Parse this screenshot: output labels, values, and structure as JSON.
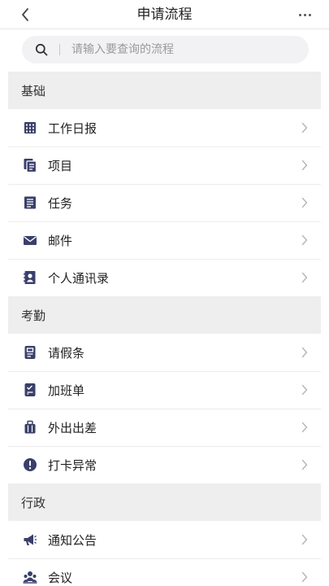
{
  "header": {
    "title": "申请流程",
    "back_icon": "chevron-left-icon",
    "more_icon": "more-dots-icon"
  },
  "search": {
    "placeholder": "请输入要查询的流程",
    "value": ""
  },
  "colors": {
    "icon": "#3a3f6b",
    "section_bg": "#eeeeee",
    "divider": "#ececec",
    "chevron": "#b5b5b5"
  },
  "sections": [
    {
      "title": "基础",
      "items": [
        {
          "label": "工作日报",
          "icon": "calendar-grid-icon"
        },
        {
          "label": "项目",
          "icon": "project-docs-icon"
        },
        {
          "label": "任务",
          "icon": "task-list-icon"
        },
        {
          "label": "邮件",
          "icon": "mail-icon"
        },
        {
          "label": "个人通讯录",
          "icon": "contact-book-icon"
        }
      ]
    },
    {
      "title": "考勤",
      "items": [
        {
          "label": "请假条",
          "icon": "leave-note-icon"
        },
        {
          "label": "加班单",
          "icon": "overtime-checklist-icon"
        },
        {
          "label": "外出出差",
          "icon": "luggage-icon"
        },
        {
          "label": "打卡异常",
          "icon": "alert-circle-icon"
        }
      ]
    },
    {
      "title": "行政",
      "items": [
        {
          "label": "通知公告",
          "icon": "megaphone-icon"
        },
        {
          "label": "会议",
          "icon": "meeting-people-icon"
        }
      ]
    }
  ]
}
